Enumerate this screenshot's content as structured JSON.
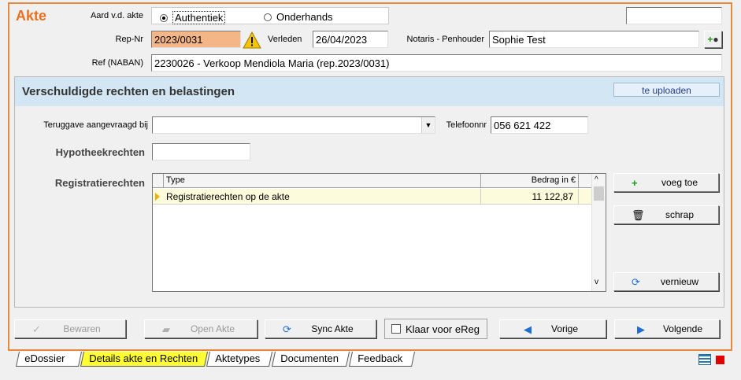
{
  "header": {
    "title": "Akte",
    "aard_label": "Aard v.d. akte",
    "aard_options": [
      "Authentiek",
      "Onderhands"
    ],
    "aard_selected": "Authentiek",
    "repnr_label": "Rep-Nr",
    "repnr_value": "2023/0031",
    "verleden_label": "Verleden",
    "verleden_value": "26/04/2023",
    "notaris_label": "Notaris - Penhouder",
    "notaris_value": "Sophie Test",
    "ref_label": "Ref (NABAN)",
    "ref_value": "2230026 - Verkoop Mendiola Maria (rep.2023/0031)",
    "top_right_value": ""
  },
  "panel": {
    "title": "Verschuldigde rechten en belastingen",
    "badge": "te uploaden",
    "teruggave_label": "Teruggave aangevraagd bij",
    "teruggave_value": "",
    "telefoon_label": "Telefoonnr",
    "telefoon_value": "056 621 422",
    "hypotheek_label": "Hypotheekrechten",
    "hypotheek_value": "",
    "registratie_label": "Registratierechten",
    "grid": {
      "columns": [
        "Type",
        "Bedrag in €"
      ],
      "rows": [
        {
          "type": "Registratierechten op de akte",
          "bedrag": "11 122,87"
        }
      ]
    },
    "buttons": {
      "add": "voeg toe",
      "delete": "schrap",
      "refresh": "vernieuw"
    }
  },
  "actions": {
    "save": "Bewaren",
    "open": "Open Akte",
    "sync": "Sync Akte",
    "klaar": "Klaar voor eReg",
    "prev": "Vorige",
    "next": "Volgende"
  },
  "tabs": [
    "eDossier",
    "Details akte en Rechten",
    "Aktetypes",
    "Documenten",
    "Feedback"
  ],
  "active_tab": "Details akte en Rechten",
  "colors": {
    "accent": "#e8893a",
    "title": "#e8701e",
    "repnr_bg": "#f5b687",
    "panel_header": "#d3e6f3",
    "active_tab": "#ffff33",
    "status_red": "#e00000"
  }
}
